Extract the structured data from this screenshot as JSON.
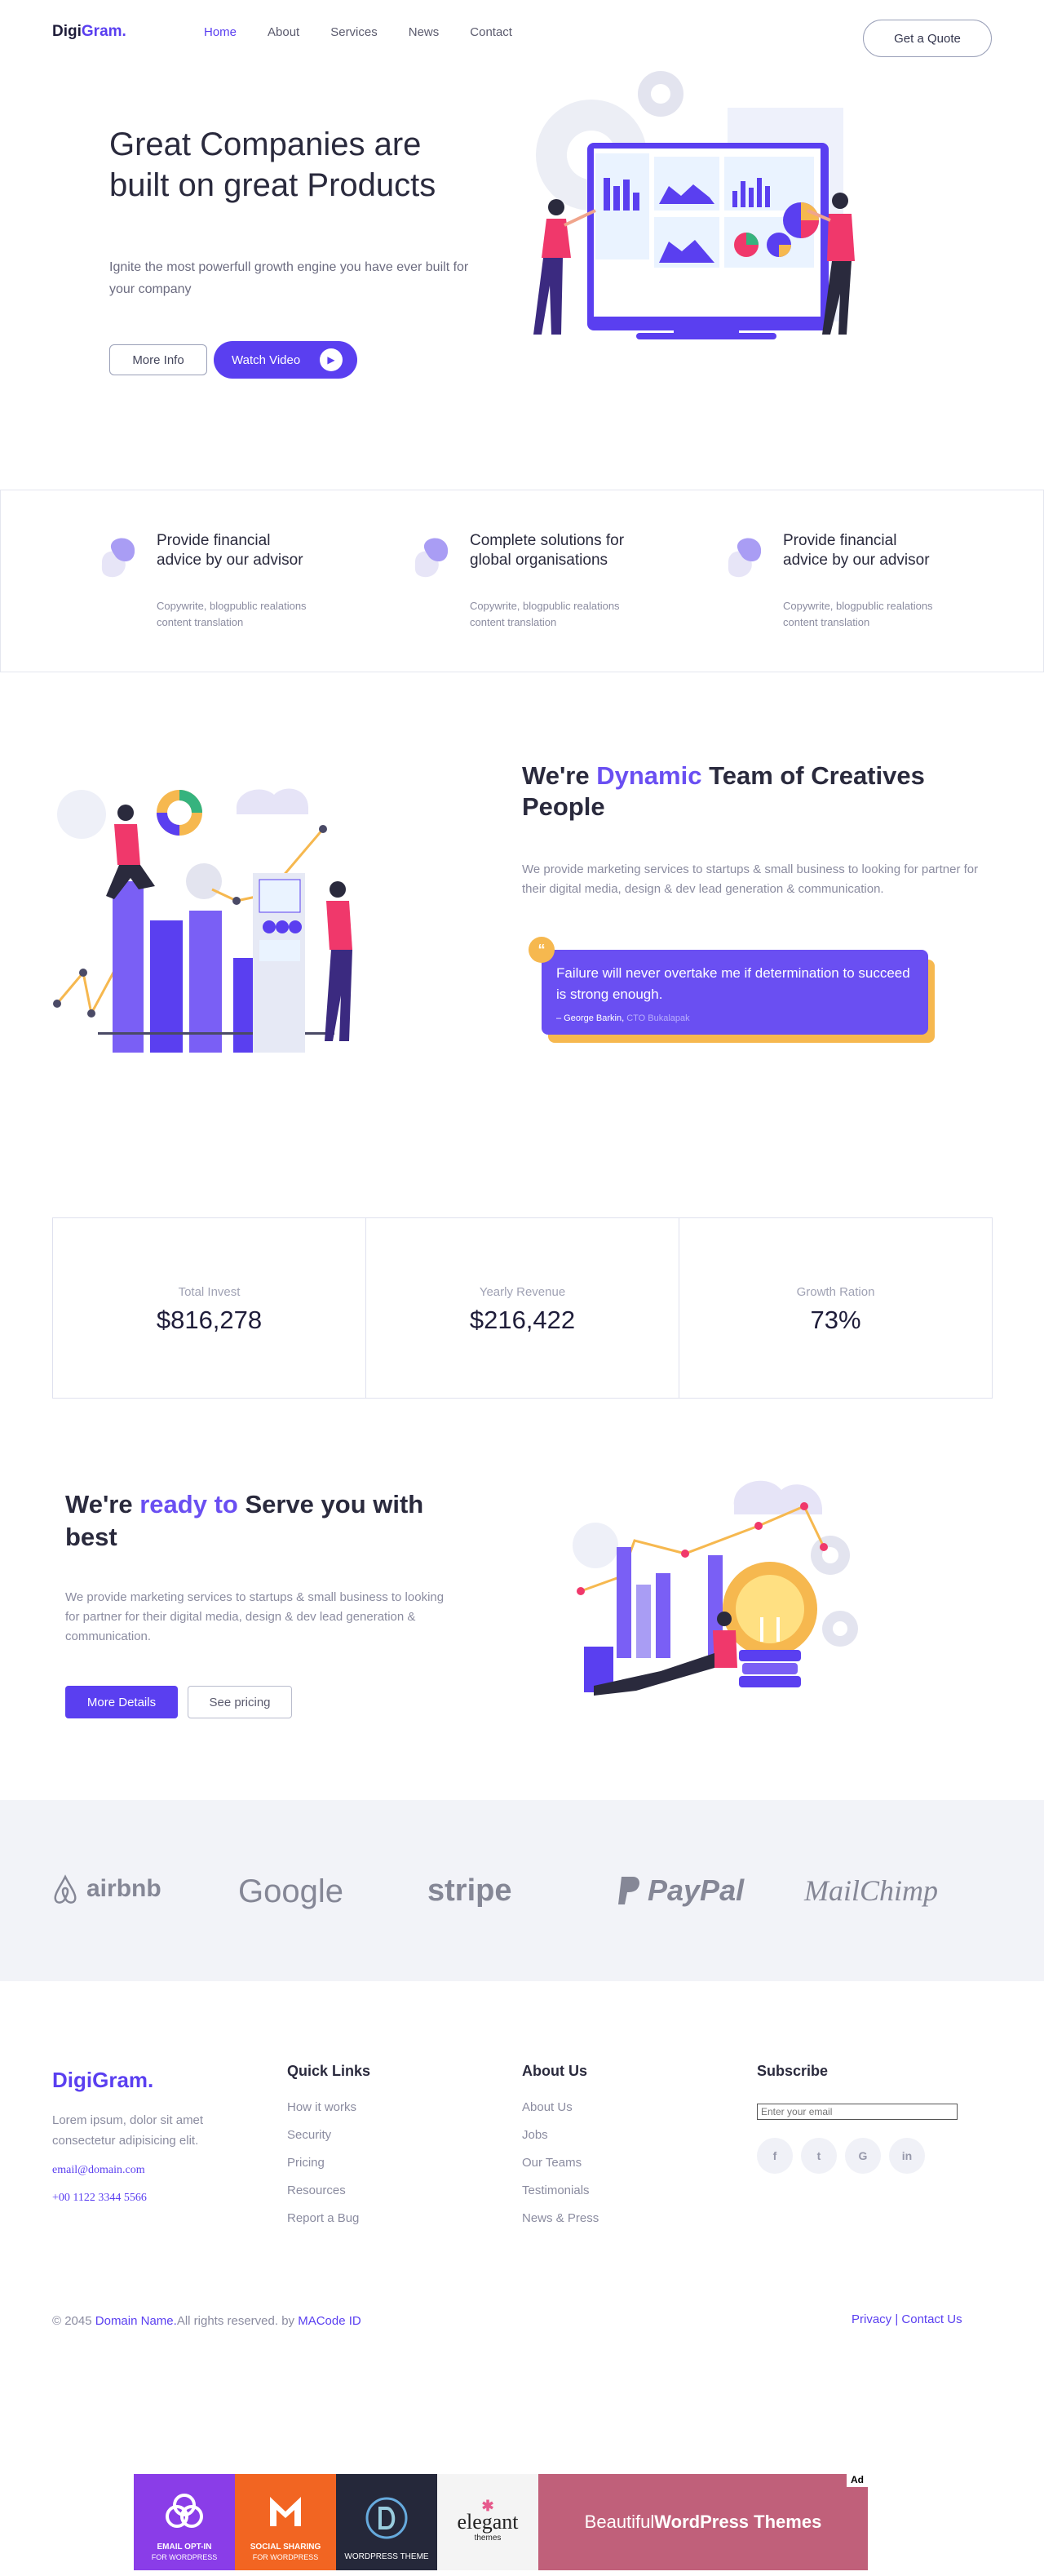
{
  "nav": {
    "logo_main": "Digi",
    "logo_accent": "Gram.",
    "links": [
      "Home",
      "About",
      "Services",
      "News",
      "Contact"
    ],
    "cta": "Get a Quote"
  },
  "hero": {
    "title": "Great Companies are built on great Products",
    "subtitle": "Ignite the most powerfull growth engine you have ever built for your company",
    "more_info": "More Info",
    "watch_video": "Watch Video"
  },
  "features": [
    {
      "title": "Provide financial advice by our advisor",
      "text": "Copywrite, blogpublic realations content translation"
    },
    {
      "title": "Complete solutions for global organisations",
      "text": "Copywrite, blogpublic realations content translation"
    },
    {
      "title": "Provide financial advice by our advisor",
      "text": "Copywrite, blogpublic realations content translation"
    }
  ],
  "team": {
    "title_pre": "We're ",
    "title_hl": "Dynamic",
    "title_post": " Team of Creatives People",
    "text": "We provide marketing services to startups & small business to looking for partner for their digital media, design & dev lead generation & communication.",
    "quote": "Failure will never overtake me if determination to succeed is strong enough.",
    "author": "– George Barkin,",
    "role": "CTO Bukalapak"
  },
  "stats": [
    {
      "label": "Total Invest",
      "value": "$816,278"
    },
    {
      "label": "Yearly Revenue",
      "value": "$216,422"
    },
    {
      "label": "Growth Ration",
      "value": "73%"
    }
  ],
  "serve": {
    "title_pre": "We're ",
    "title_hl": "ready to",
    "title_post": " Serve you with best",
    "text": "We provide marketing services to startups & small business to looking for partner for their digital media, design & dev lead generation & communication.",
    "primary": "More Details",
    "secondary": "See pricing"
  },
  "brands": [
    "airbnb",
    "Google",
    "stripe",
    "PayPal",
    "MailChimp"
  ],
  "footer": {
    "logo_main": "Digi",
    "logo_accent": "Gram.",
    "desc": "Lorem ipsum, dolor sit amet consectetur adipisicing elit.",
    "email": "email@domain.com",
    "phone": "+00 1122 3344 5566",
    "quick_links": {
      "title": "Quick Links",
      "items": [
        "How it works",
        "Security",
        "Pricing",
        "Resources",
        "Report a Bug"
      ]
    },
    "about": {
      "title": "About Us",
      "items": [
        "About Us",
        "Jobs",
        "Our Teams",
        "Testimonials",
        "News & Press"
      ]
    },
    "subscribe": {
      "title": "Subscribe",
      "placeholder": "Enter your email"
    },
    "socials": [
      "f",
      "t",
      "G",
      "in"
    ],
    "copy_pre": "© 2045 ",
    "copy_domain": "Domain Name.",
    "copy_mid": "All rights reserved. by ",
    "copy_author": "MACode ID",
    "legal": "Privacy | Contact Us"
  },
  "ad": {
    "tag": "Ad",
    "tiles": [
      {
        "label": "EMAIL OPT-IN",
        "sub": "FOR WORDPRESS",
        "color": "#8a3de8"
      },
      {
        "label": "SOCIAL SHARING",
        "sub": "FOR WORDPRESS",
        "color": "#f26522"
      },
      {
        "label": "WORDPRESS THEME",
        "sub": "",
        "color": "#25283a"
      },
      {
        "label": "elegant",
        "sub": "themes",
        "color": "#f4f4f4"
      }
    ],
    "banner_pre": "Beautiful ",
    "banner_bold": "WordPress Themes",
    "banner_color": "#c0607a"
  },
  "colors": {
    "accent": "#5a3ff0",
    "accent_light": "#6a4ff2",
    "pink": "#f0386b",
    "gold": "#f6b84f"
  }
}
